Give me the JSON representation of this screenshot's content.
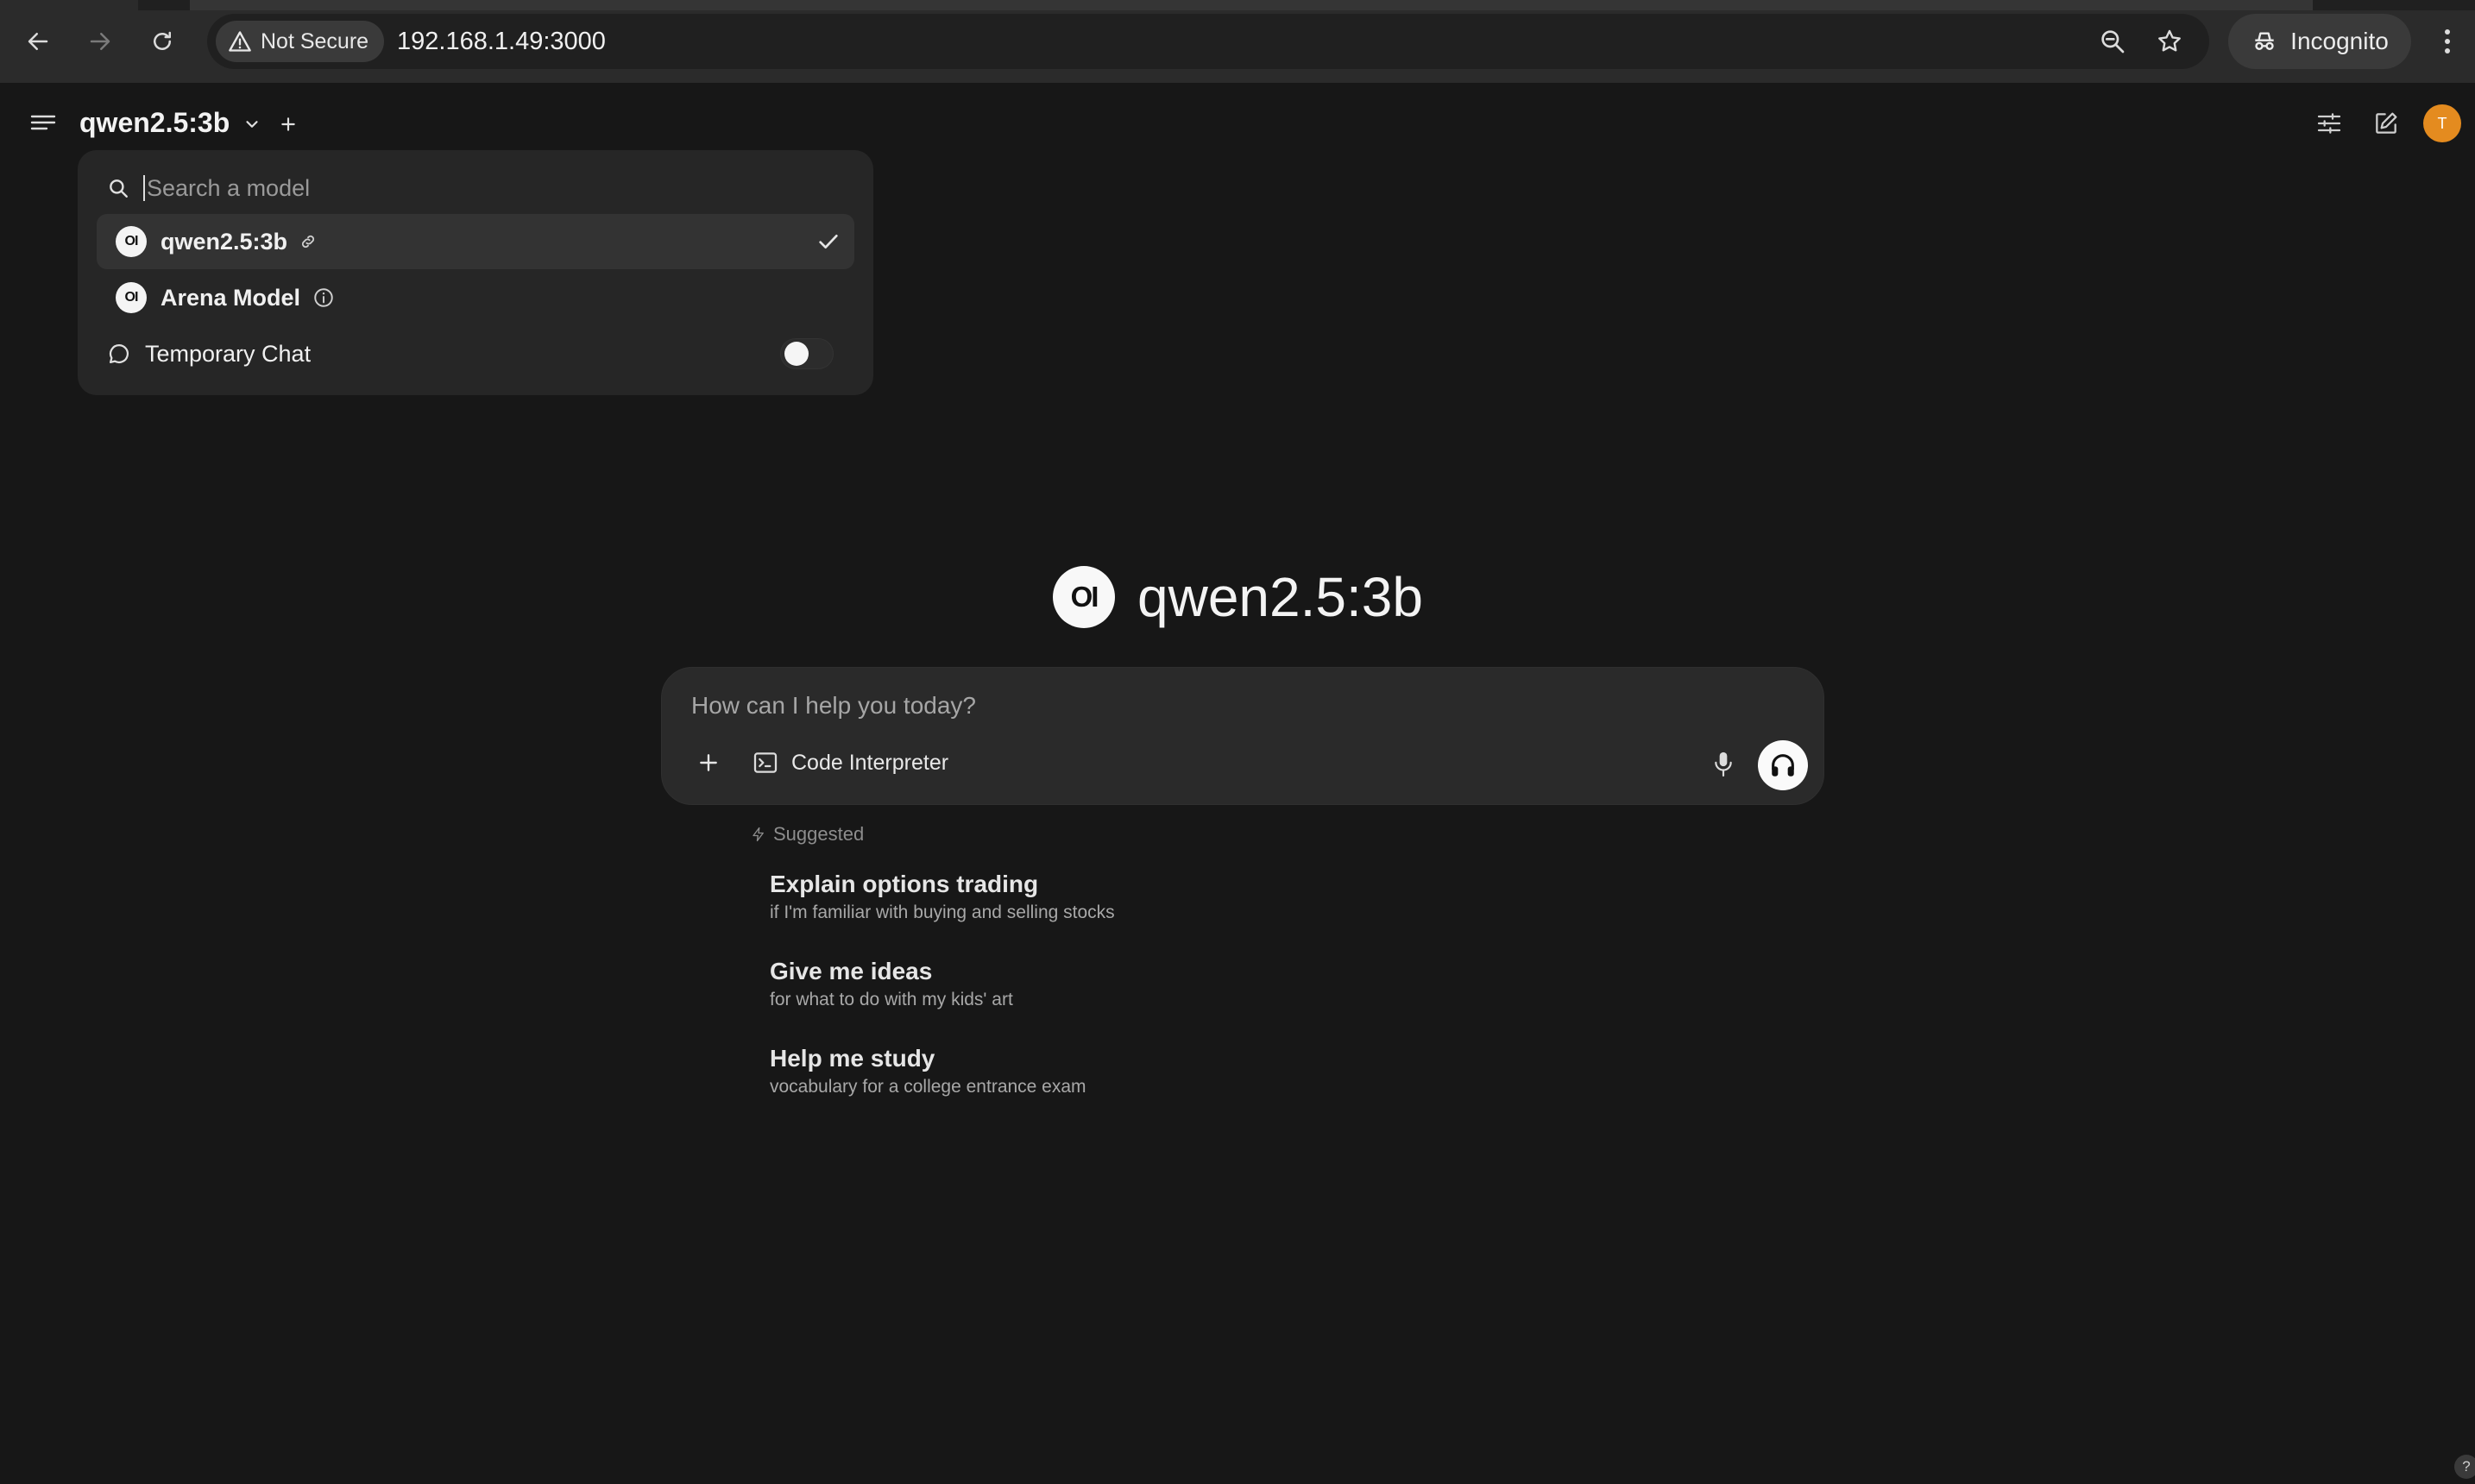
{
  "browser": {
    "security_label": "Not Secure",
    "url": "192.168.1.49:3000",
    "incognito_label": "Incognito"
  },
  "header": {
    "model_title": "qwen2.5:3b",
    "avatar_initial": "T",
    "avatar_color": "#e48b1f"
  },
  "model_dropdown": {
    "search_placeholder": "Search a model",
    "items": [
      {
        "label": "qwen2.5:3b",
        "selected": true,
        "icon": "link-icon"
      },
      {
        "label": "Arena Model",
        "selected": false,
        "icon": "info-icon"
      }
    ],
    "temporary_chat": {
      "label": "Temporary Chat",
      "enabled": false
    }
  },
  "hero": {
    "logo_text": "OI",
    "title": "qwen2.5:3b"
  },
  "composer": {
    "placeholder": "How can I help you today?",
    "code_interpreter_label": "Code Interpreter"
  },
  "suggestions": {
    "heading": "Suggested",
    "items": [
      {
        "title": "Explain options trading",
        "subtitle": "if I'm familiar with buying and selling stocks"
      },
      {
        "title": "Give me ideas",
        "subtitle": "for what to do with my kids' art"
      },
      {
        "title": "Help me study",
        "subtitle": "vocabulary for a college entrance exam"
      }
    ]
  },
  "help": {
    "label": "?"
  }
}
